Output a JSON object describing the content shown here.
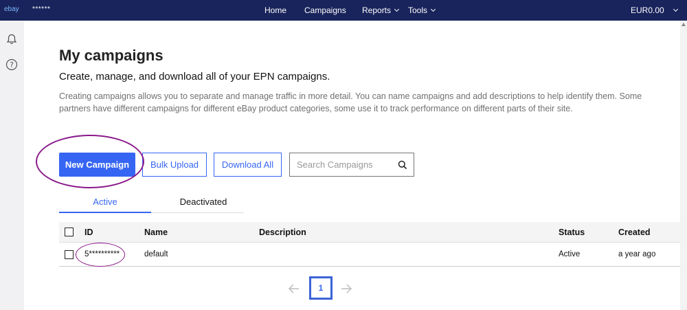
{
  "topbar": {
    "logo": "ebay",
    "user": "******",
    "nav": [
      {
        "label": "Home"
      },
      {
        "label": "Campaigns"
      },
      {
        "label": "Reports"
      },
      {
        "label": "Tools"
      }
    ],
    "currency": "EUR0.00"
  },
  "sidebar": {
    "icons": [
      "bell-icon",
      "help-icon"
    ]
  },
  "page": {
    "title": "My campaigns",
    "subtitle": "Create, manage, and download all of your EPN campaigns.",
    "description": "Creating campaigns allows you to separate and manage traffic in more detail. You can name campaigns and add descriptions to help identify them. Some partners have different campaigns for different eBay product categories, some use it to track performance on different parts of their site."
  },
  "actions": {
    "new_campaign": "New Campaign",
    "bulk_upload": "Bulk Upload",
    "download_all": "Download All",
    "search_placeholder": "Search Campaigns"
  },
  "tabs": [
    {
      "label": "Active",
      "active": true
    },
    {
      "label": "Deactivated",
      "active": false
    }
  ],
  "table": {
    "columns": [
      "ID",
      "Name",
      "Description",
      "Status",
      "Created"
    ],
    "rows": [
      {
        "id": "5**********",
        "name": "default",
        "description": "",
        "status": "Active",
        "created": "a year ago"
      }
    ]
  },
  "pagination": {
    "current": "1"
  },
  "colors": {
    "topbar": "#19245c",
    "accent": "#3665f3",
    "annotation": "#8a1a8a"
  }
}
